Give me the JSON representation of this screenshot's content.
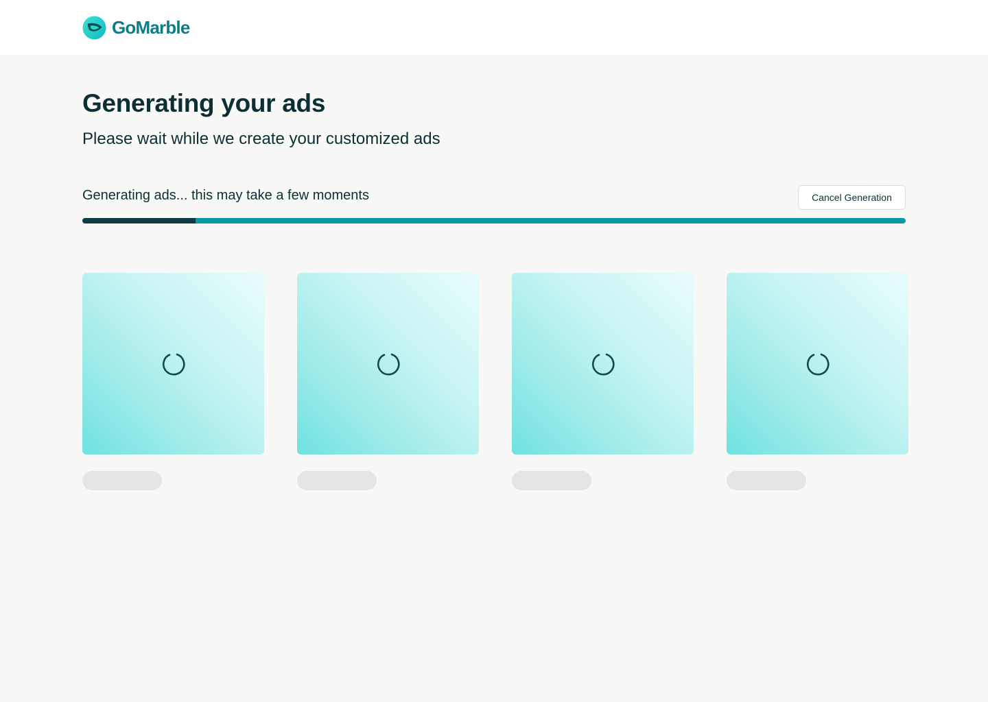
{
  "brand": {
    "name": "GoMarble",
    "logo_icon": "leaf-icon",
    "colors": {
      "primary": "#0e7c86",
      "accent": "#1fd0cf",
      "dark": "#0d3b3f"
    }
  },
  "page": {
    "title": "Generating your ads",
    "subtitle": "Please wait while we create your customized ads"
  },
  "progress": {
    "status_text": "Generating ads... this may take a few moments",
    "cancel_label": "Cancel Generation",
    "value_percent": 13.75,
    "fill_color": "#0f3c43",
    "track_color": "#0a9aa6"
  },
  "ads": [
    {
      "state": "loading",
      "icon": "spinner-icon"
    },
    {
      "state": "loading",
      "icon": "spinner-icon"
    },
    {
      "state": "loading",
      "icon": "spinner-icon"
    },
    {
      "state": "loading",
      "icon": "spinner-icon"
    }
  ]
}
